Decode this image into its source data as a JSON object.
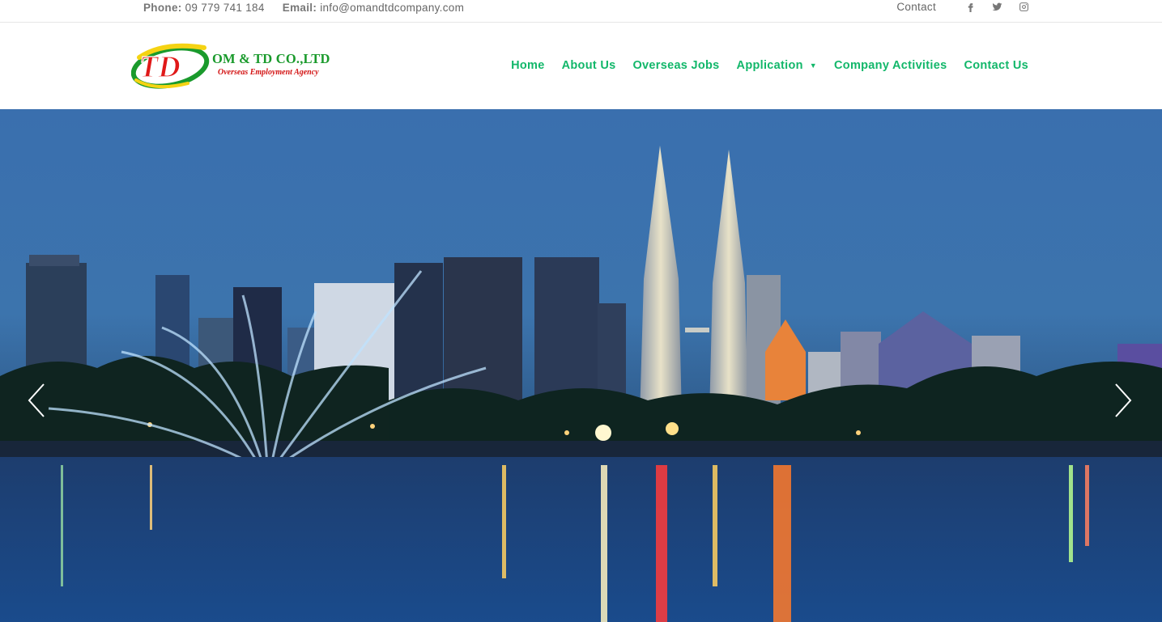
{
  "topbar": {
    "phone_label": "Phone:",
    "phone_value": "09 779 741 184",
    "email_label": "Email:",
    "email_value": "info@omandtdcompany.com",
    "contact_link": "Contact",
    "social": [
      "facebook-icon",
      "twitter-icon",
      "instagram-icon"
    ]
  },
  "logo": {
    "mark": "TD",
    "brand": "OM & TD CO.,LTD",
    "tagline": "Overseas Employment Agency"
  },
  "nav": {
    "items": [
      {
        "label": "Home"
      },
      {
        "label": "About Us"
      },
      {
        "label": "Overseas Jobs"
      },
      {
        "label": "Application",
        "has_dropdown": true
      },
      {
        "label": "Company Activities"
      },
      {
        "label": "Contact Us"
      }
    ]
  },
  "hero": {
    "prev_icon": "chevron-left-icon",
    "next_icon": "chevron-right-icon"
  },
  "colors": {
    "nav_accent": "#12b76a",
    "brand_green": "#1a9a2c",
    "brand_red": "#d31313",
    "logo_yellow": "#f5d313"
  }
}
